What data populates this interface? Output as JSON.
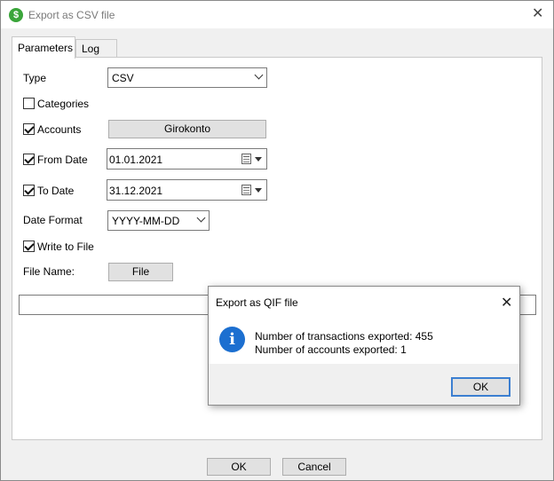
{
  "window": {
    "title": "Export as CSV file",
    "app_icon_glyph": "$",
    "close_glyph": "✕"
  },
  "tabs": [
    {
      "label": "Parameters",
      "active": true
    },
    {
      "label": "Log",
      "active": false
    }
  ],
  "form": {
    "type_label": "Type",
    "type_value": "CSV",
    "categories_label": "Categories",
    "categories_checked": false,
    "accounts_label": "Accounts",
    "accounts_checked": true,
    "accounts_button": "Girokonto",
    "from_date_label": "From Date",
    "from_date_checked": true,
    "from_date_value": "01.01.2021",
    "to_date_label": "To Date",
    "to_date_checked": true,
    "to_date_value": "31.12.2021",
    "date_format_label": "Date Format",
    "date_format_value": "YYYY-MM-DD",
    "write_to_file_label": "Write to File",
    "write_to_file_checked": true,
    "file_name_label": "File Name:",
    "file_button": "File",
    "file_path_value": ""
  },
  "footer": {
    "ok_label": "OK",
    "cancel_label": "Cancel"
  },
  "dialog": {
    "title": "Export as QIF file",
    "close_glyph": "✕",
    "icon": "info-icon",
    "icon_glyph": "i",
    "line1": "Number of transactions exported: 455",
    "line2": "Number of accounts exported: 1",
    "ok_label": "OK"
  },
  "colors": {
    "info_blue": "#1c6fd0",
    "app_icon_green": "#3aa53a",
    "focus_border": "#3c7fd1"
  }
}
